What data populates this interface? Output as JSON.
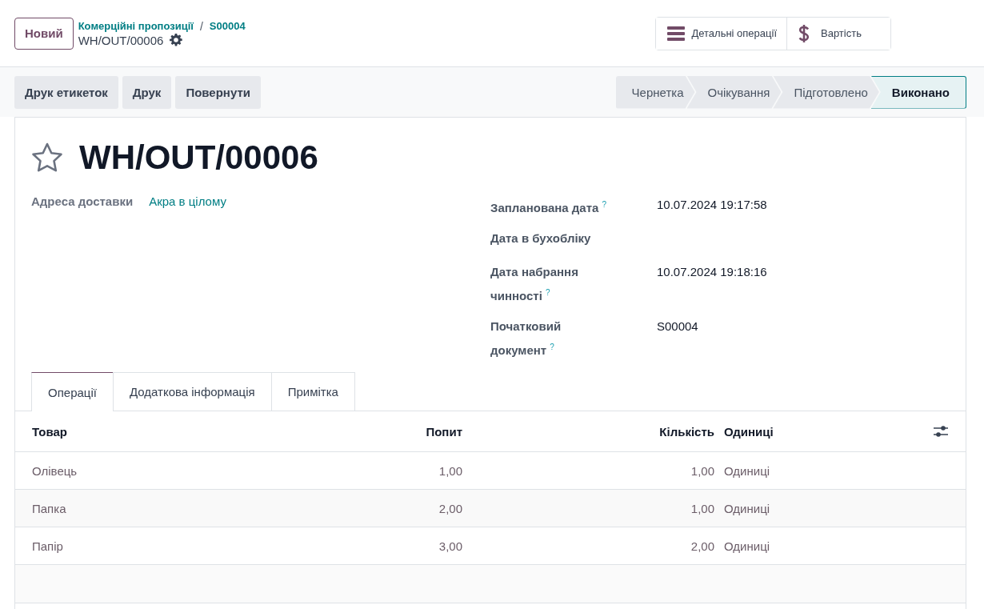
{
  "new_button": "Новий",
  "breadcrumbs": [
    {
      "label": "Комерційні пропозиції"
    },
    {
      "label": "S00004"
    }
  ],
  "breadcrumb_separator": "/",
  "record_name": "WH/OUT/00006",
  "smart_buttons": [
    {
      "kind": "list",
      "label": "Детальні операції"
    },
    {
      "kind": "dollar",
      "label": "Вартість"
    }
  ],
  "action_buttons": [
    "Друк етикеток",
    "Друк",
    "Повернути"
  ],
  "statusbar": [
    {
      "label": "Чернетка",
      "selected": false
    },
    {
      "label": "Очікування",
      "selected": false
    },
    {
      "label": "Підготовлено",
      "selected": false
    },
    {
      "label": "Виконано",
      "selected": true
    }
  ],
  "title": {
    "text": "WH/OUT/00006",
    "starred": false
  },
  "left_fields": [
    {
      "label": "Адреса доставки",
      "value": "Акра в цілому",
      "kind": "link"
    }
  ],
  "right_fields": [
    {
      "label": "Запланована дата $^{?}$",
      "value": "10.07.2024 19:17:58"
    },
    {
      "label": "Дата в бухобліку"
    },
    {
      "label": "Дата набрання чинності $^{?}$",
      "value": "10.07.2024 19:18:16"
    },
    {
      "label": "Початковий документ $^{?}$",
      "value": "S00004"
    }
  ],
  "tabs": [
    {
      "label": "Операції",
      "selected": true
    },
    {
      "label": "Додаткова інформація",
      "selected": false
    },
    {
      "label": "Примітка",
      "selected": false
    }
  ],
  "table": {
    "columns": [
      "Товар",
      "Попит",
      "Кількість",
      "Одиниці"
    ],
    "rows": [
      {
        "cells": [
          "Олівець",
          "1,00",
          "1,00",
          "Одиниці"
        ]
      },
      {
        "cells": [
          "Папка",
          "2,00",
          "1,00",
          "Одиниці"
        ]
      },
      {
        "cells": [
          "Папір",
          "3,00",
          "2,00",
          "Одиниці"
        ]
      }
    ]
  }
}
